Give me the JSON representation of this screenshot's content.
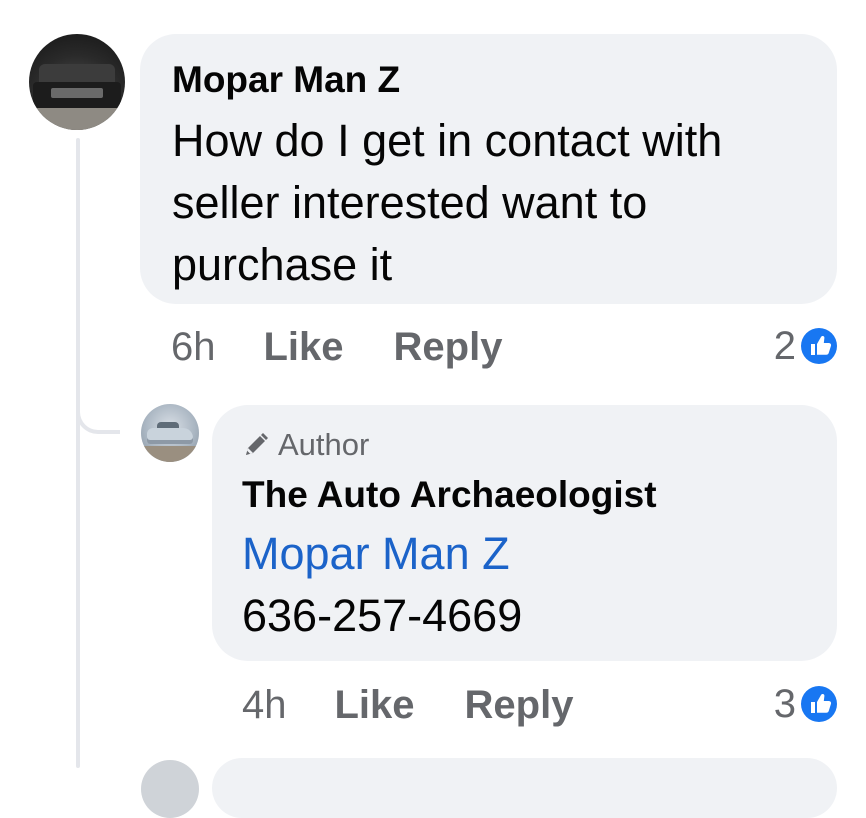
{
  "colors": {
    "bubble_bg": "#f0f2f5",
    "secondary_text": "#65676b",
    "link_blue": "#1b63c9",
    "like_blue": "#1877f2",
    "thread_line": "#e4e6eb"
  },
  "comments": [
    {
      "author": "Mopar Man Z",
      "text": "How do I get in contact with seller interested want to purchase it",
      "time": "6h",
      "like_label": "Like",
      "reply_label": "Reply",
      "reaction_count": "2",
      "reaction_icon": "thumbs-up-icon",
      "avatar_icon": "user-avatar"
    }
  ],
  "replies": [
    {
      "badge_icon": "pencil-icon",
      "badge_label": "Author",
      "author": "The Auto Archaeologist",
      "mention": "Mopar Man Z",
      "text": "636-257-4669",
      "time": "4h",
      "like_label": "Like",
      "reply_label": "Reply",
      "reaction_count": "3",
      "reaction_icon": "thumbs-up-icon",
      "avatar_icon": "page-avatar"
    }
  ]
}
